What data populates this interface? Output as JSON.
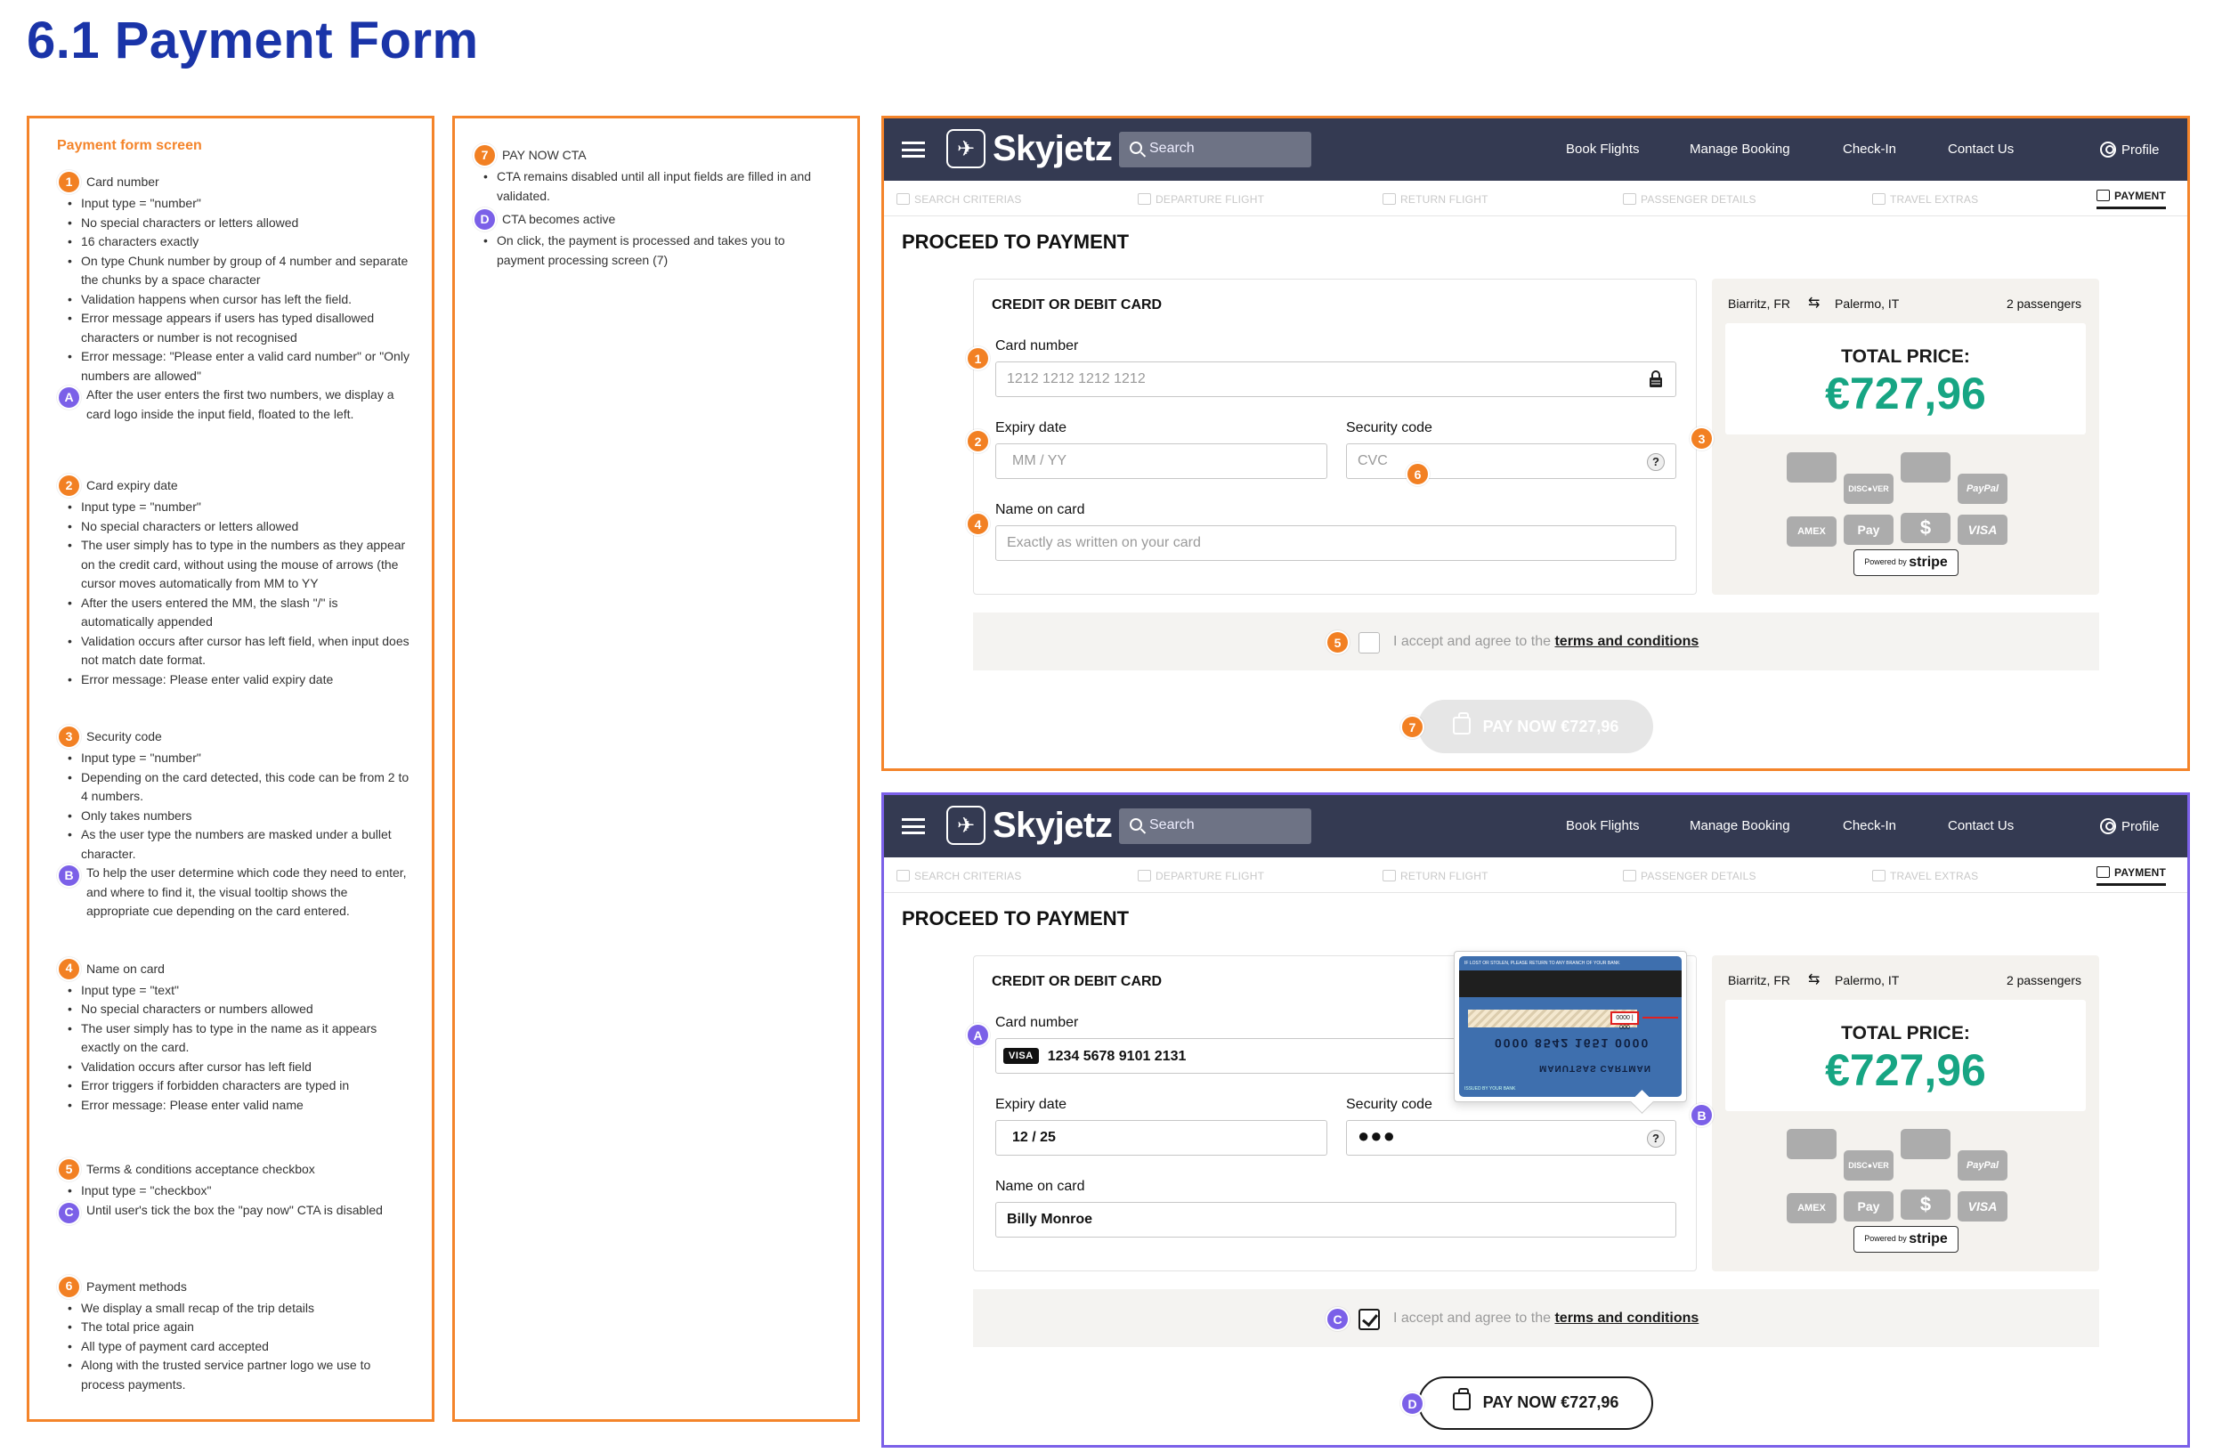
{
  "page_title": "6.1 Payment Form",
  "notes": {
    "heading": "Payment form screen",
    "card_number": {
      "marker": "1",
      "title": "Card number",
      "bullets": [
        "Input type = \"number\"",
        "No special characters or letters allowed",
        "16 characters exactly",
        "On type Chunk number by group of 4 number and separate the chunks by a space character",
        "Validation happens when cursor has left the field.",
        "Error message appears if users has typed disallowed characters or number is not recognised",
        "Error message: \"Please enter a valid card number\" or \"Only numbers are allowed\""
      ],
      "sub_marker": "A",
      "sub_text": "After the user enters the first two numbers, we display a card logo inside the input field, floated to the left."
    },
    "expiry": {
      "marker": "2",
      "title": "Card expiry date",
      "bullets": [
        "Input type = \"number\"",
        "No special characters or letters allowed",
        "The user simply has to type in the numbers as they appear on the credit card, without using the mouse of arrows (the cursor moves automatically from MM to YY",
        "After the users entered the MM, the slash \"/\" is automatically appended",
        "Validation occurs after cursor has left field, when input does not match date format.",
        "Error message: Please enter valid expiry date"
      ]
    },
    "security": {
      "marker": "3",
      "title": "Security code",
      "bullets": [
        "Input type = \"number\"",
        "Depending on the card detected, this code can be from 2 to 4 numbers.",
        "Only takes numbers",
        "As the user type the numbers are masked under a bullet character."
      ],
      "sub_marker": "B",
      "sub_text": "To help the user determine which code they need to enter, and where to find it,  the visual tooltip shows the appropriate cue depending on the card entered."
    },
    "name": {
      "marker": "4",
      "title": "Name on card",
      "bullets": [
        "Input type = \"text\"",
        "No special characters or numbers allowed",
        "The user simply has to type in the name as it appears exactly  on the card.",
        "Validation occurs after cursor has left field",
        "Error triggers if forbidden characters are typed in",
        "Error message: Please enter valid name"
      ]
    },
    "terms": {
      "marker": "5",
      "title": "Terms & conditions acceptance checkbox",
      "bullets": [
        "Input type = \"checkbox\""
      ],
      "sub_marker": "C",
      "sub_text": "Until user's tick the box the \"pay now\" CTA is disabled"
    },
    "payment_methods": {
      "marker": "6",
      "title": "Payment methods",
      "bullets": [
        "We display a small recap of the trip details",
        "The total price again",
        "All type of payment card accepted",
        "Along with the trusted service partner logo we use to process payments."
      ]
    },
    "pay_cta": {
      "marker": "7",
      "title": "PAY NOW CTA",
      "bullets": [
        "CTA remains disabled until all input fields are filled in and validated."
      ],
      "sub_marker": "D",
      "sub_title": "CTA becomes active",
      "sub_bullets": [
        "On click, the payment is processed and takes you to payment processing screen (7)"
      ]
    }
  },
  "app": {
    "logo": "Skyjetz",
    "search_placeholder": "Search",
    "nav": [
      "Book Flights",
      "Manage Booking",
      "Check-In",
      "Contact Us"
    ],
    "profile": "Profile",
    "steps": [
      "SEARCH CRITERIAS",
      "DEPARTURE FLIGHT",
      "RETURN FLIGHT",
      "PASSENGER DETAILS",
      "TRAVEL EXTRAS",
      "PAYMENT"
    ],
    "heading": "PROCEED TO PAYMENT",
    "card_section": "CREDIT OR DEBIT CARD",
    "labels": {
      "card_number": "Card number",
      "expiry": "Expiry date",
      "security": "Security code",
      "name": "Name on card"
    },
    "placeholders": {
      "card_number": "1212  1212  1212  1212",
      "expiry": "MM  /  YY",
      "security": "CVC",
      "name": "Exactly as written on your card"
    },
    "filled": {
      "card_brand": "VISA",
      "card_number": "1234 5678 9101 2131",
      "expiry": "12  /  25",
      "security": "●●●",
      "name": "Billy Monroe"
    },
    "trip": {
      "from": "Biarritz, FR",
      "to": "Palermo, IT",
      "passengers": "2 passengers"
    },
    "total_label": "TOTAL PRICE:",
    "total_value": "€727,96",
    "payment_logos": [
      "",
      "DISC●VER",
      "",
      "PayPal",
      "AMEX",
      "Pay",
      "$",
      "VISA"
    ],
    "stripe": {
      "prefix": "Powered by",
      "brand": "stripe"
    },
    "terms_text": "I accept and agree to the ",
    "terms_link": "terms and conditions",
    "pay_button": "PAY NOW €727,96",
    "card_back": {
      "top_text": "IF LOST OR STOLEN, PLEASE RETURN TO ANY BRANCH OF YOUR BANK",
      "cvc": "0000 | 000",
      "number": "0000 8542 1651 0000",
      "name": "MANUTSAS CARTMAN",
      "bank": "ISSUED BY YOUR BANK"
    }
  },
  "colors": {
    "title_blue": "#1a34a8",
    "annotation_orange": "#f28023",
    "annotation_purple": "#7b60e8",
    "price_green": "#17a583",
    "topbar": "#343a52"
  }
}
